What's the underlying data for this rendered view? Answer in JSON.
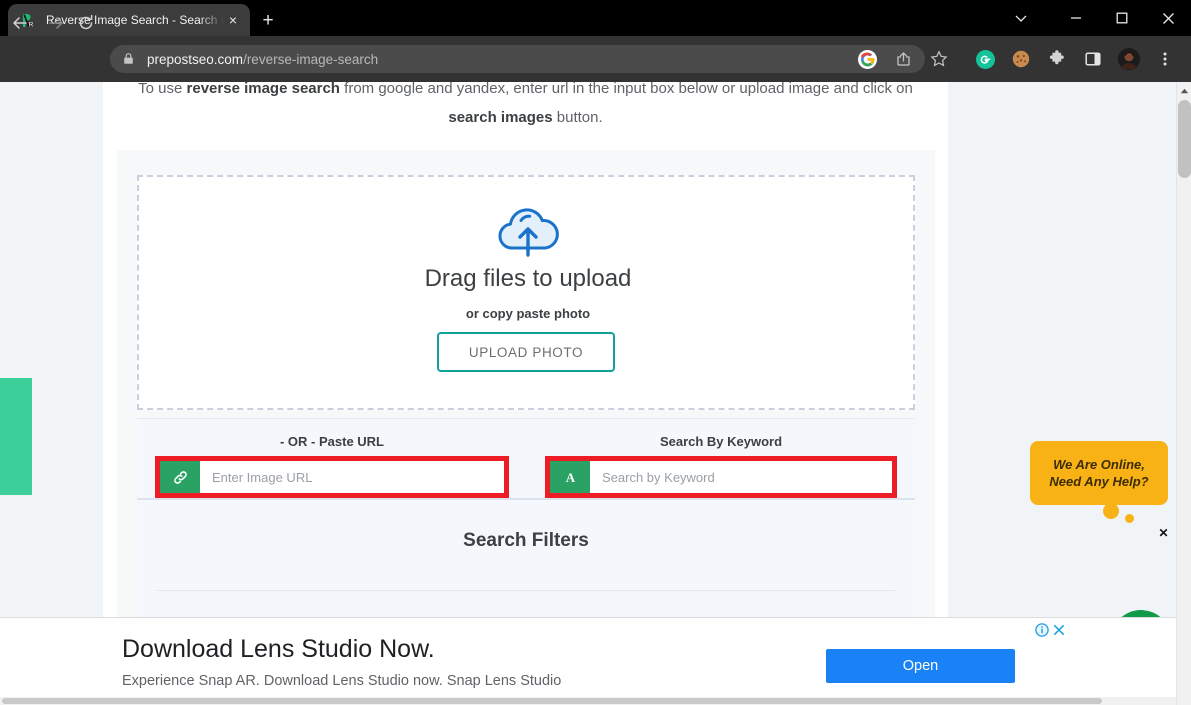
{
  "browser": {
    "tab": {
      "title": "Reverse Image Search - Search By",
      "favicon": "prepostseo-favicon",
      "close_label": "×"
    },
    "newtab_label": "+",
    "window_controls": {
      "tab_search": "tab-search-chevron",
      "minimize": "—",
      "maximize": "□",
      "close": "✕"
    },
    "nav": {
      "back": "←",
      "forward": "→",
      "reload": "⟳"
    },
    "omnibox": {
      "lock_icon": "lock-icon",
      "domain": "prepostseo.com",
      "path": "/reverse-image-search"
    },
    "toolbar_icons": [
      {
        "name": "google-icon",
        "label": "G"
      },
      {
        "name": "share-icon",
        "label": "share"
      },
      {
        "name": "bookmark-star-icon",
        "label": "star"
      },
      {
        "name": "grammarly-extension-icon",
        "label": "G"
      },
      {
        "name": "cookie-extension-icon",
        "label": "cookie"
      },
      {
        "name": "extensions-puzzle-icon",
        "label": "puzzle"
      },
      {
        "name": "side-panel-icon",
        "label": "panel"
      },
      {
        "name": "profile-avatar",
        "label": "avatar"
      },
      {
        "name": "chrome-menu-icon",
        "label": "⋮"
      }
    ]
  },
  "page": {
    "intro_line1_pre": "To use ",
    "intro_line1_bold": "reverse image search",
    "intro_line1_post": " from google and yandex, enter url in the input box below or upload image and click on",
    "intro_line2_bold": "search images",
    "intro_line2_post": " button.",
    "upload": {
      "cloud_icon": "cloud-upload-icon",
      "title": "Drag files to upload",
      "subtitle": "or copy paste photo",
      "button_label": "UPLOAD PHOTO"
    },
    "url_input": {
      "label": "- OR - Paste URL",
      "prefix_icon": "link-chain-icon",
      "placeholder": "Enter Image URL",
      "value": ""
    },
    "keyword_input": {
      "label": "Search By Keyword",
      "prefix_icon": "font-letter-a-icon",
      "placeholder": "Search by Keyword",
      "value": ""
    },
    "filters": {
      "title": "Search Filters"
    },
    "side_tab": {
      "name": "feedback-tab",
      "color": "#3ccf9a"
    }
  },
  "chat_widget": {
    "bubble_line1": "We Are Online,",
    "bubble_line2": "Need Any Help?",
    "bubble_color": "#f9b216",
    "close_label": "✕",
    "fab_icon": "chat-bubble-icon",
    "fab_color": "#0f9b4a"
  },
  "corner_close": {
    "label": "✕"
  },
  "ad": {
    "title": "Download Lens Studio Now.",
    "subtitle": "Experience Snap AR. Download Lens Studio now. Snap Lens Studio",
    "cta_label": "Open",
    "info_icon": "ad-info-icon",
    "close_icon": "ad-close-icon",
    "cta_color": "#1a82f7"
  }
}
